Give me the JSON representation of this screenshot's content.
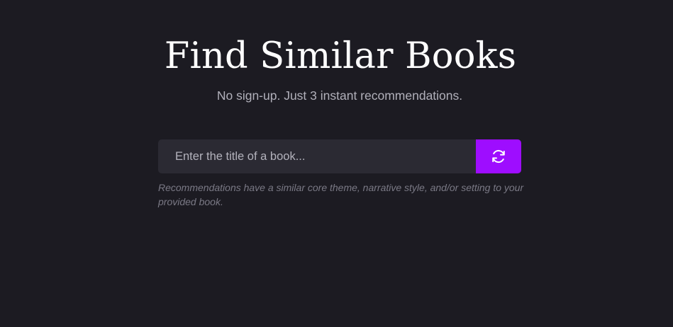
{
  "header": {
    "title": "Find Similar Books",
    "subtitle": "No sign-up. Just 3 instant recommendations."
  },
  "search": {
    "value": "",
    "placeholder": "Enter the title of a book...",
    "button_icon": "refresh-icon"
  },
  "hint": {
    "text": "Recommendations have a similar core theme, narrative style, and/or setting to your provided book."
  },
  "colors": {
    "background": "#1c1b22",
    "input_background": "#2b2a33",
    "accent": "#9e0dff",
    "title": "#ffffff",
    "subtitle": "#b1b0ba",
    "hint": "#7a7985"
  }
}
